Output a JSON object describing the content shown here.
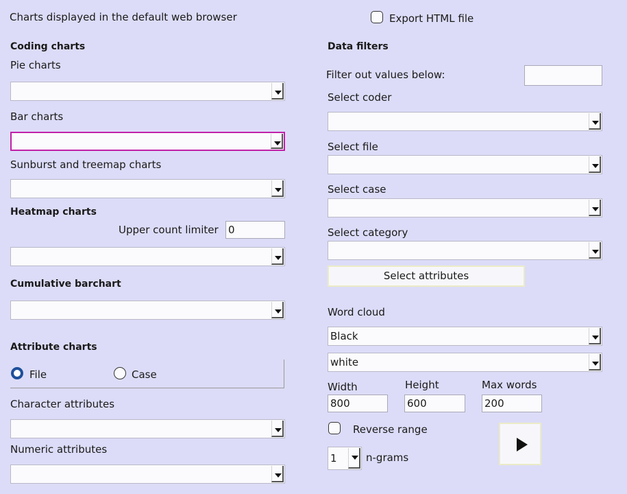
{
  "header": {
    "info": "Charts displayed in the default web browser",
    "export_label": "Export HTML file"
  },
  "coding": {
    "heading": "Coding charts",
    "pie_label": "Pie charts",
    "bar_label": "Bar charts",
    "sunburst_label": "Sunburst and treemap charts"
  },
  "heatmap": {
    "heading": "Heatmap charts",
    "limiter_label": "Upper count limiter",
    "limiter_value": "0"
  },
  "cumulative": {
    "heading": "Cumulative barchart"
  },
  "attribute": {
    "heading": "Attribute charts",
    "file_label": "File",
    "case_label": "Case",
    "character_label": "Character attributes",
    "numeric_label": "Numeric attributes"
  },
  "filters": {
    "heading": "Data filters",
    "filter_below_label": "Filter out values below:",
    "filter_below_value": "",
    "coder_label": "Select coder",
    "file_label": "Select file",
    "case_label": "Select case",
    "category_label": "Select category",
    "attributes_button": "Select attributes"
  },
  "wordcloud": {
    "label": "Word cloud",
    "foreground": "Black",
    "background": "white",
    "width_label": "Width",
    "width_value": "800",
    "height_label": "Height",
    "height_value": "600",
    "maxwords_label": "Max words",
    "maxwords_value": "200",
    "reverse_label": "Reverse range",
    "ngram_value": "1",
    "ngram_label": "n-grams"
  },
  "colors": {
    "background": "#dcdcf8",
    "focus_border": "#c020a8",
    "radio_selected": "#1e4f9a"
  }
}
